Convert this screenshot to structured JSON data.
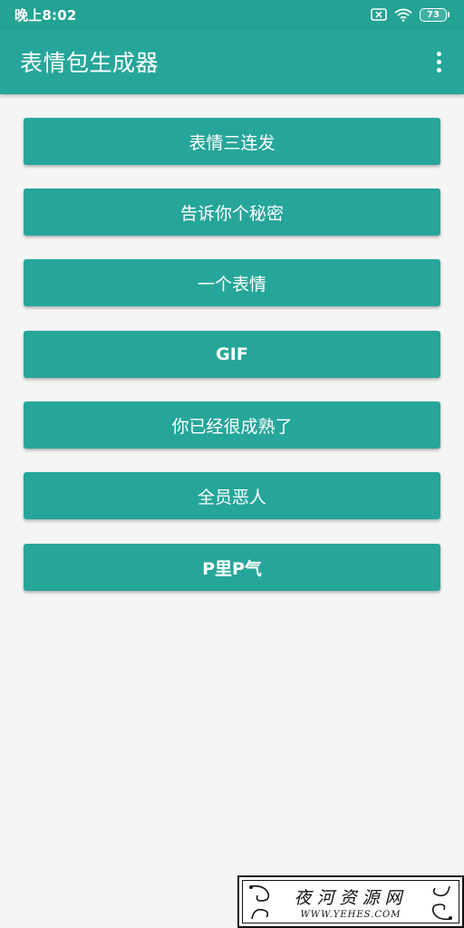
{
  "status_bar": {
    "time": "晚上8:02",
    "battery": "73",
    "icons": [
      "sim-off-icon",
      "wifi-icon",
      "battery-icon"
    ]
  },
  "app_bar": {
    "title": "表情包生成器",
    "menu_icon": "more-vert-icon"
  },
  "buttons": [
    {
      "label": "表情三连发"
    },
    {
      "label": "告诉你个秘密"
    },
    {
      "label": "一个表情"
    },
    {
      "label": "GIF"
    },
    {
      "label": "你已经很成熟了"
    },
    {
      "label": "全员恶人"
    },
    {
      "label": "P里P气"
    }
  ],
  "watermark": {
    "text": "夜河资源网",
    "url": "WWW.YEHES.COM"
  },
  "colors": {
    "primary": "#26a69a",
    "primary_dark": "#22a394",
    "background": "#f5f5f5",
    "text_on_primary": "#ffffff"
  }
}
